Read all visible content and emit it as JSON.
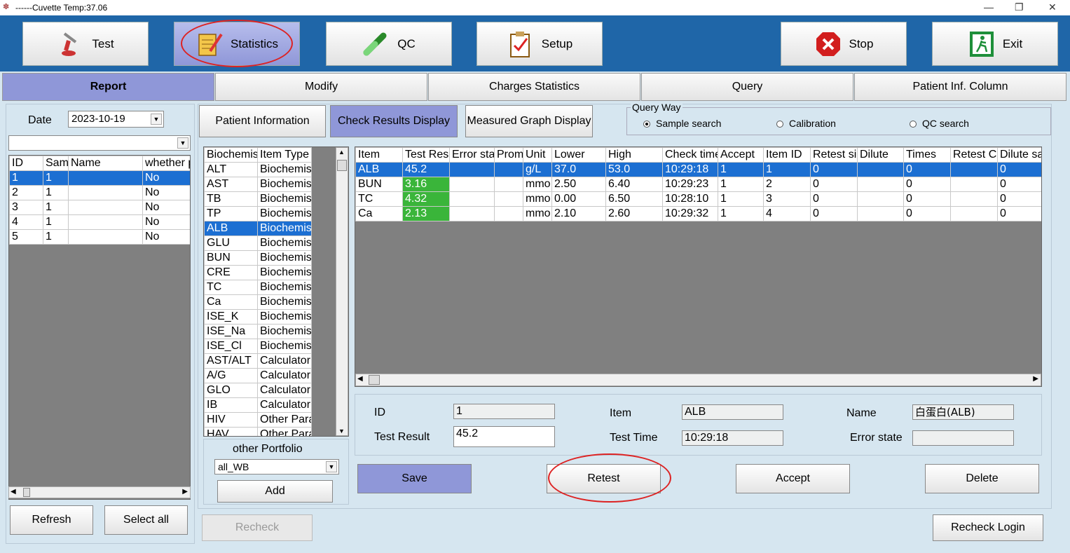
{
  "title_bar": {
    "text": "------Cuvette Temp:37.06",
    "minimize": "—",
    "restore": "❐",
    "close": "✕"
  },
  "toolbar": {
    "test": "Test",
    "statistics": "Statistics",
    "qc": "QC",
    "setup": "Setup",
    "stop": "Stop",
    "exit": "Exit"
  },
  "tabs": [
    "Report",
    "Modify",
    "Charges Statistics",
    "Query",
    "Patient Inf. Column"
  ],
  "left": {
    "date_label": "Date",
    "date_value": "2023-10-19",
    "filter_value": "",
    "headers": [
      "ID",
      "Sam",
      "Name",
      "whether p"
    ],
    "rows": [
      [
        "1",
        "1",
        "",
        "No"
      ],
      [
        "2",
        "1",
        "",
        "No"
      ],
      [
        "3",
        "1",
        "",
        "No"
      ],
      [
        "4",
        "1",
        "",
        "No"
      ],
      [
        "5",
        "1",
        "",
        "No"
      ]
    ],
    "refresh": "Refresh",
    "select_all": "Select all"
  },
  "view_buttons": {
    "patient_info": "Patient Information",
    "check_results": "Check Results Display",
    "measured_graph": "Measured Graph Display"
  },
  "query_way": {
    "label": "Query Way",
    "sample": "Sample search",
    "calibration": "Calibration",
    "qc": "QC search"
  },
  "items": {
    "headers": [
      "Biochemis",
      "Item Type"
    ],
    "rows": [
      [
        "ALT",
        "Biochemis"
      ],
      [
        "AST",
        "Biochemis"
      ],
      [
        "TB",
        "Biochemis"
      ],
      [
        "TP",
        "Biochemis"
      ],
      [
        "ALB",
        "Biochemis"
      ],
      [
        "GLU",
        "Biochemis"
      ],
      [
        "BUN",
        "Biochemis"
      ],
      [
        "CRE",
        "Biochemis"
      ],
      [
        "TC",
        "Biochemis"
      ],
      [
        "Ca",
        "Biochemis"
      ],
      [
        "ISE_K",
        "Biochemis"
      ],
      [
        "ISE_Na",
        "Biochemis"
      ],
      [
        "ISE_Cl",
        "Biochemis"
      ],
      [
        "AST/ALT",
        "Calculator"
      ],
      [
        "A/G",
        "Calculator"
      ],
      [
        "GLO",
        "Calculator"
      ],
      [
        "IB",
        "Calculator"
      ],
      [
        "HIV",
        "Other Para"
      ],
      [
        "HAV",
        "Other Para"
      ]
    ],
    "other_portfolio": "other Portfolio",
    "portfolio_value": "all_WB",
    "add": "Add"
  },
  "results": {
    "headers": [
      "Item",
      "Test Res",
      "Error sta",
      "Prom",
      "Unit",
      "Lower",
      "High",
      "Check time",
      "Accept",
      "Item ID",
      "Retest si",
      "Dilute",
      "Times",
      "Retest C",
      "Dilute sa"
    ],
    "rows": [
      [
        "ALB",
        "45.2",
        "",
        "",
        "g/L",
        "37.0",
        "53.0",
        "10:29:18",
        "1",
        "1",
        "0",
        "",
        "0",
        "",
        "0"
      ],
      [
        "BUN",
        "3.16",
        "",
        "",
        "mmo",
        "2.50",
        "6.40",
        "10:29:23",
        "1",
        "2",
        "0",
        "",
        "0",
        "",
        "0"
      ],
      [
        "TC",
        "4.32",
        "",
        "",
        "mmo",
        "0.00",
        "6.50",
        "10:28:10",
        "1",
        "3",
        "0",
        "",
        "0",
        "",
        "0"
      ],
      [
        "Ca",
        "2.13",
        "",
        "",
        "mmo",
        "2.10",
        "2.60",
        "10:29:32",
        "1",
        "4",
        "0",
        "",
        "0",
        "",
        "0"
      ]
    ]
  },
  "detail": {
    "id_label": "ID",
    "id_value": "1",
    "item_label": "Item",
    "item_value": "ALB",
    "name_label": "Name",
    "name_value": "白蛋白(ALB)",
    "result_label": "Test Result",
    "result_value": "45.2",
    "time_label": "Test Time",
    "time_value": "10:29:18",
    "error_label": "Error state",
    "error_value": ""
  },
  "actions": {
    "save": "Save",
    "retest": "Retest",
    "accept": "Accept",
    "delete": "Delete",
    "recheck": "Recheck",
    "recheck_login": "Recheck Login"
  },
  "colors": {
    "toolbar": "#1f66a8",
    "selected": "#8f97d8",
    "highlight_row": "#1c6fd2",
    "in_range": "#3ab53a",
    "annotation": "#dd2222"
  }
}
